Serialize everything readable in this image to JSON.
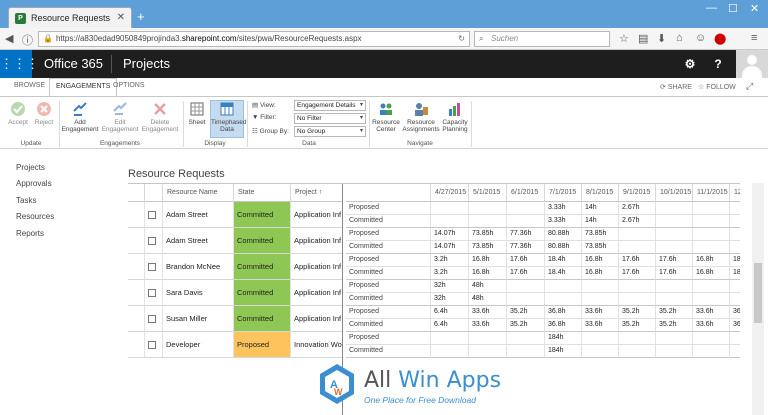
{
  "browser": {
    "tab_title": "Resource Requests",
    "url_prefix": "https://a830edad9050849projinda3.",
    "url_domain": "sharepoint.com",
    "url_path": "/sites/pwa/ResourceRequests.aspx",
    "search_placeholder": "Suchen"
  },
  "suite": {
    "brand": "Office 365",
    "app": "Projects"
  },
  "ribbon": {
    "tabs": [
      "BROWSE",
      "ENGAGEMENTS",
      "OPTIONS"
    ],
    "active_tab": "ENGAGEMENTS",
    "share_label": "SHARE",
    "follow_label": "FOLLOW",
    "update": {
      "accept": "Accept",
      "reject": "Reject",
      "group": "Update"
    },
    "engagements": {
      "add": "Add Engagement",
      "edit": "Edit Engagement",
      "delete": "Delete Engagement",
      "group": "Engagements"
    },
    "display": {
      "sheet": "Sheet",
      "timephased": "Timephased Data",
      "group": "Display"
    },
    "data": {
      "view_label": "View:",
      "view_value": "Engagement Details",
      "filter_label": "Filter:",
      "filter_value": "No Filter",
      "groupby_label": "Group By:",
      "groupby_value": "No Group",
      "group": "Data"
    },
    "navigate": {
      "rc": "Resource Center",
      "ra": "Resource Assignments",
      "cp": "Capacity Planning",
      "group": "Navigate"
    }
  },
  "leftnav": [
    "Projects",
    "Approvals",
    "Tasks",
    "Resources",
    "Reports"
  ],
  "page_title": "Resource Requests",
  "grid": {
    "headers": {
      "name": "Resource Name",
      "state": "State",
      "project": "Project",
      "sort_icon": "↑"
    },
    "rows": [
      {
        "name": "Adam Street",
        "state": "Committed",
        "project": "Application Inf"
      },
      {
        "name": "Adam Street",
        "state": "Committed",
        "project": "Application Inf"
      },
      {
        "name": "Brandon McNee",
        "state": "Committed",
        "project": "Application Inf"
      },
      {
        "name": "Sara Davis",
        "state": "Committed",
        "project": "Application Inf"
      },
      {
        "name": "Susan Miller",
        "state": "Committed",
        "project": "Application Inf"
      },
      {
        "name": "Developer",
        "state": "Proposed",
        "project": "Innovation Wo"
      }
    ],
    "colors": {
      "committed": "#8fc755",
      "proposed": "#fdc35c"
    }
  },
  "timephased": {
    "dates": [
      "4/27/2015",
      "5/1/2015",
      "6/1/2015",
      "7/1/2015",
      "8/1/2015",
      "9/1/2015",
      "10/1/2015",
      "11/1/2015",
      "12"
    ],
    "rows": [
      {
        "label": "Proposed",
        "values": [
          "",
          "",
          "",
          "3.33h",
          "14h",
          "2.67h",
          "",
          "",
          ""
        ]
      },
      {
        "label": "Committed",
        "values": [
          "",
          "",
          "",
          "3.33h",
          "14h",
          "2.67h",
          "",
          "",
          ""
        ]
      },
      {
        "label": "Proposed",
        "values": [
          "14.07h",
          "73.85h",
          "77.36h",
          "80.88h",
          "73.85h",
          "",
          "",
          "",
          ""
        ]
      },
      {
        "label": "Committed",
        "values": [
          "14.07h",
          "73.85h",
          "77.36h",
          "80.88h",
          "73.85h",
          "",
          "",
          "",
          ""
        ]
      },
      {
        "label": "Proposed",
        "values": [
          "3.2h",
          "16.8h",
          "17.6h",
          "18.4h",
          "16.8h",
          "17.6h",
          "17.6h",
          "16.8h",
          "18"
        ]
      },
      {
        "label": "Committed",
        "values": [
          "3.2h",
          "16.8h",
          "17.6h",
          "18.4h",
          "16.8h",
          "17.6h",
          "17.6h",
          "16.8h",
          "18"
        ]
      },
      {
        "label": "Proposed",
        "values": [
          "32h",
          "48h",
          "",
          "",
          "",
          "",
          "",
          "",
          ""
        ]
      },
      {
        "label": "Committed",
        "values": [
          "32h",
          "48h",
          "",
          "",
          "",
          "",
          "",
          "",
          ""
        ]
      },
      {
        "label": "Proposed",
        "values": [
          "6.4h",
          "33.6h",
          "35.2h",
          "36.8h",
          "33.6h",
          "35.2h",
          "35.2h",
          "33.6h",
          "36"
        ]
      },
      {
        "label": "Committed",
        "values": [
          "6.4h",
          "33.6h",
          "35.2h",
          "36.8h",
          "33.6h",
          "35.2h",
          "35.2h",
          "33.6h",
          "36"
        ]
      },
      {
        "label": "Proposed",
        "values": [
          "",
          "",
          "",
          "184h",
          "",
          "",
          "",
          "",
          ""
        ]
      },
      {
        "label": "Committed",
        "values": [
          "",
          "",
          "",
          "184h",
          "",
          "",
          "",
          "",
          ""
        ]
      }
    ]
  },
  "watermark": {
    "title_a": "All ",
    "title_b": "Win Apps",
    "subtitle": "One Place for Free Download"
  }
}
